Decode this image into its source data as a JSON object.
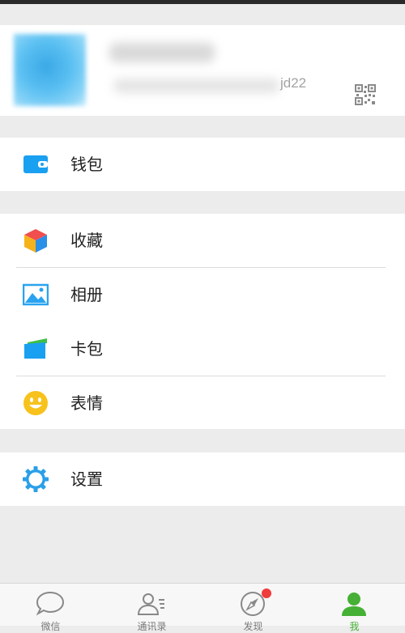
{
  "profile": {
    "wechat_id_suffix": "jd22",
    "qr_icon": "qr-code-icon"
  },
  "menu": {
    "wallet": {
      "label": "钱包",
      "icon": "wallet-icon",
      "color": "#1aa0f0"
    },
    "favorites": {
      "label": "收藏",
      "icon": "cube-icon"
    },
    "album": {
      "label": "相册",
      "icon": "image-icon",
      "color": "#29a3ef"
    },
    "cards": {
      "label": "卡包",
      "icon": "card-icon"
    },
    "stickers": {
      "label": "表情",
      "icon": "smiley-icon",
      "color": "#f7c21b"
    },
    "settings": {
      "label": "设置",
      "icon": "gear-icon",
      "color": "#2b9fe8"
    }
  },
  "tabs": [
    {
      "label": "微信",
      "icon": "chat-bubble-icon"
    },
    {
      "label": "通讯录",
      "icon": "contacts-icon"
    },
    {
      "label": "发现",
      "icon": "compass-icon",
      "badge": true
    },
    {
      "label": "我",
      "icon": "person-icon",
      "active": true
    }
  ],
  "colors": {
    "accent_green": "#45b035",
    "badge_red": "#f03c3c",
    "background": "#ececec"
  }
}
